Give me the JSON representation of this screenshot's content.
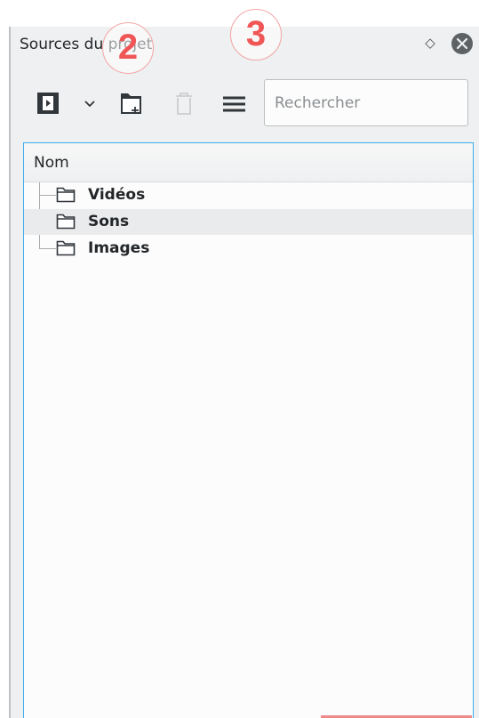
{
  "panel": {
    "title": "Sources du projet",
    "float_glyph": "◇",
    "float_icon": "float-diamond-icon",
    "close_icon": "close-circle-icon"
  },
  "toolbar": {
    "items": [
      {
        "name": "add-clip-button",
        "icon": "film-clip-icon",
        "enabled": true
      },
      {
        "name": "add-clip-menu-button",
        "icon": "chevron-down-icon",
        "enabled": true
      },
      {
        "name": "add-folder-button",
        "icon": "folder-new-icon",
        "enabled": true
      },
      {
        "name": "delete-button",
        "icon": "trash-icon",
        "enabled": false
      },
      {
        "name": "menu-button",
        "icon": "hamburger-menu-icon",
        "enabled": true
      }
    ]
  },
  "search": {
    "placeholder": "Rechercher",
    "value": ""
  },
  "tree": {
    "header": "Nom",
    "items": [
      {
        "label": "Vidéos",
        "icon": "folder-icon",
        "selected": false
      },
      {
        "label": "Sons",
        "icon": "folder-icon",
        "selected": true
      },
      {
        "label": "Images",
        "icon": "folder-icon",
        "selected": false
      }
    ]
  },
  "annotations": [
    {
      "label": "2"
    },
    {
      "label": "3"
    }
  ],
  "colors": {
    "accent": "#3daee9",
    "annotation": "#f05656",
    "selected_row": "#eaebec",
    "panel_bg": "#eff0f1"
  }
}
